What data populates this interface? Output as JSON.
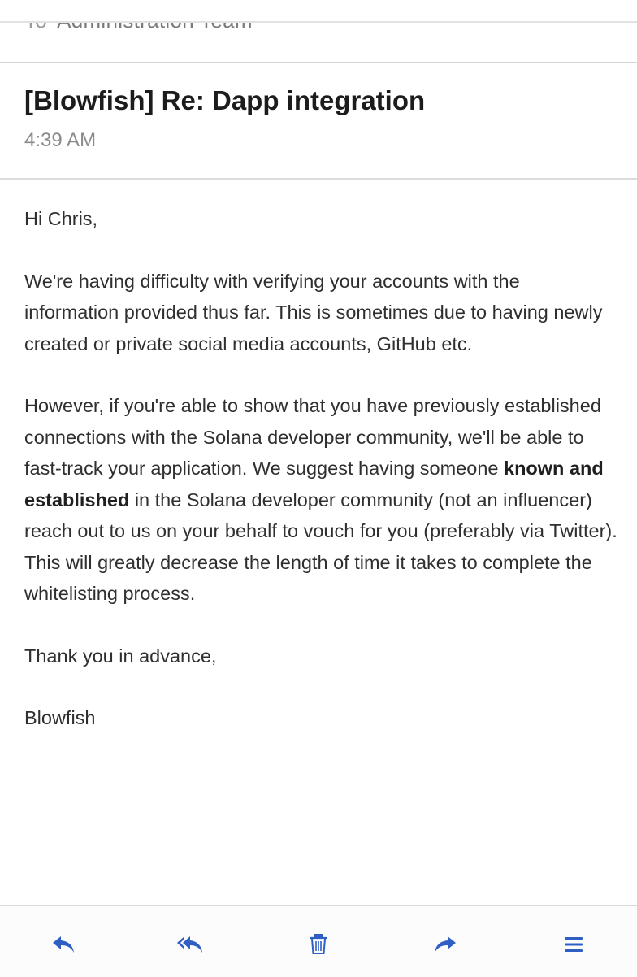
{
  "email": {
    "to_label": "To",
    "to_value": "Administration Team",
    "subject": "[Blowfish] Re: Dapp integration",
    "time": "4:39 AM",
    "greeting": "Hi Chris,",
    "para1": "We're having difficulty with verifying your accounts with the information provided thus far. This is sometimes due to having newly created or private social media accounts, GitHub etc.",
    "para2_start": "However, if you're able to show that you have previously established connections with the Solana developer community, we'll be able to fast-track your application. We suggest having someone ",
    "para2_bold": "known and established",
    "para2_end": " in the Solana developer community (not an influencer) reach out to us on your behalf to vouch for you (preferably via Twitter). This will greatly decrease the length of time it takes to complete the whitelisting process.",
    "closing": "Thank you in advance,",
    "signature": "Blowfish"
  },
  "toolbar": {
    "accent_color": "#2f5ec4",
    "icons": [
      "reply-icon",
      "reply-all-icon",
      "trash-icon",
      "forward-icon",
      "menu-icon"
    ]
  }
}
